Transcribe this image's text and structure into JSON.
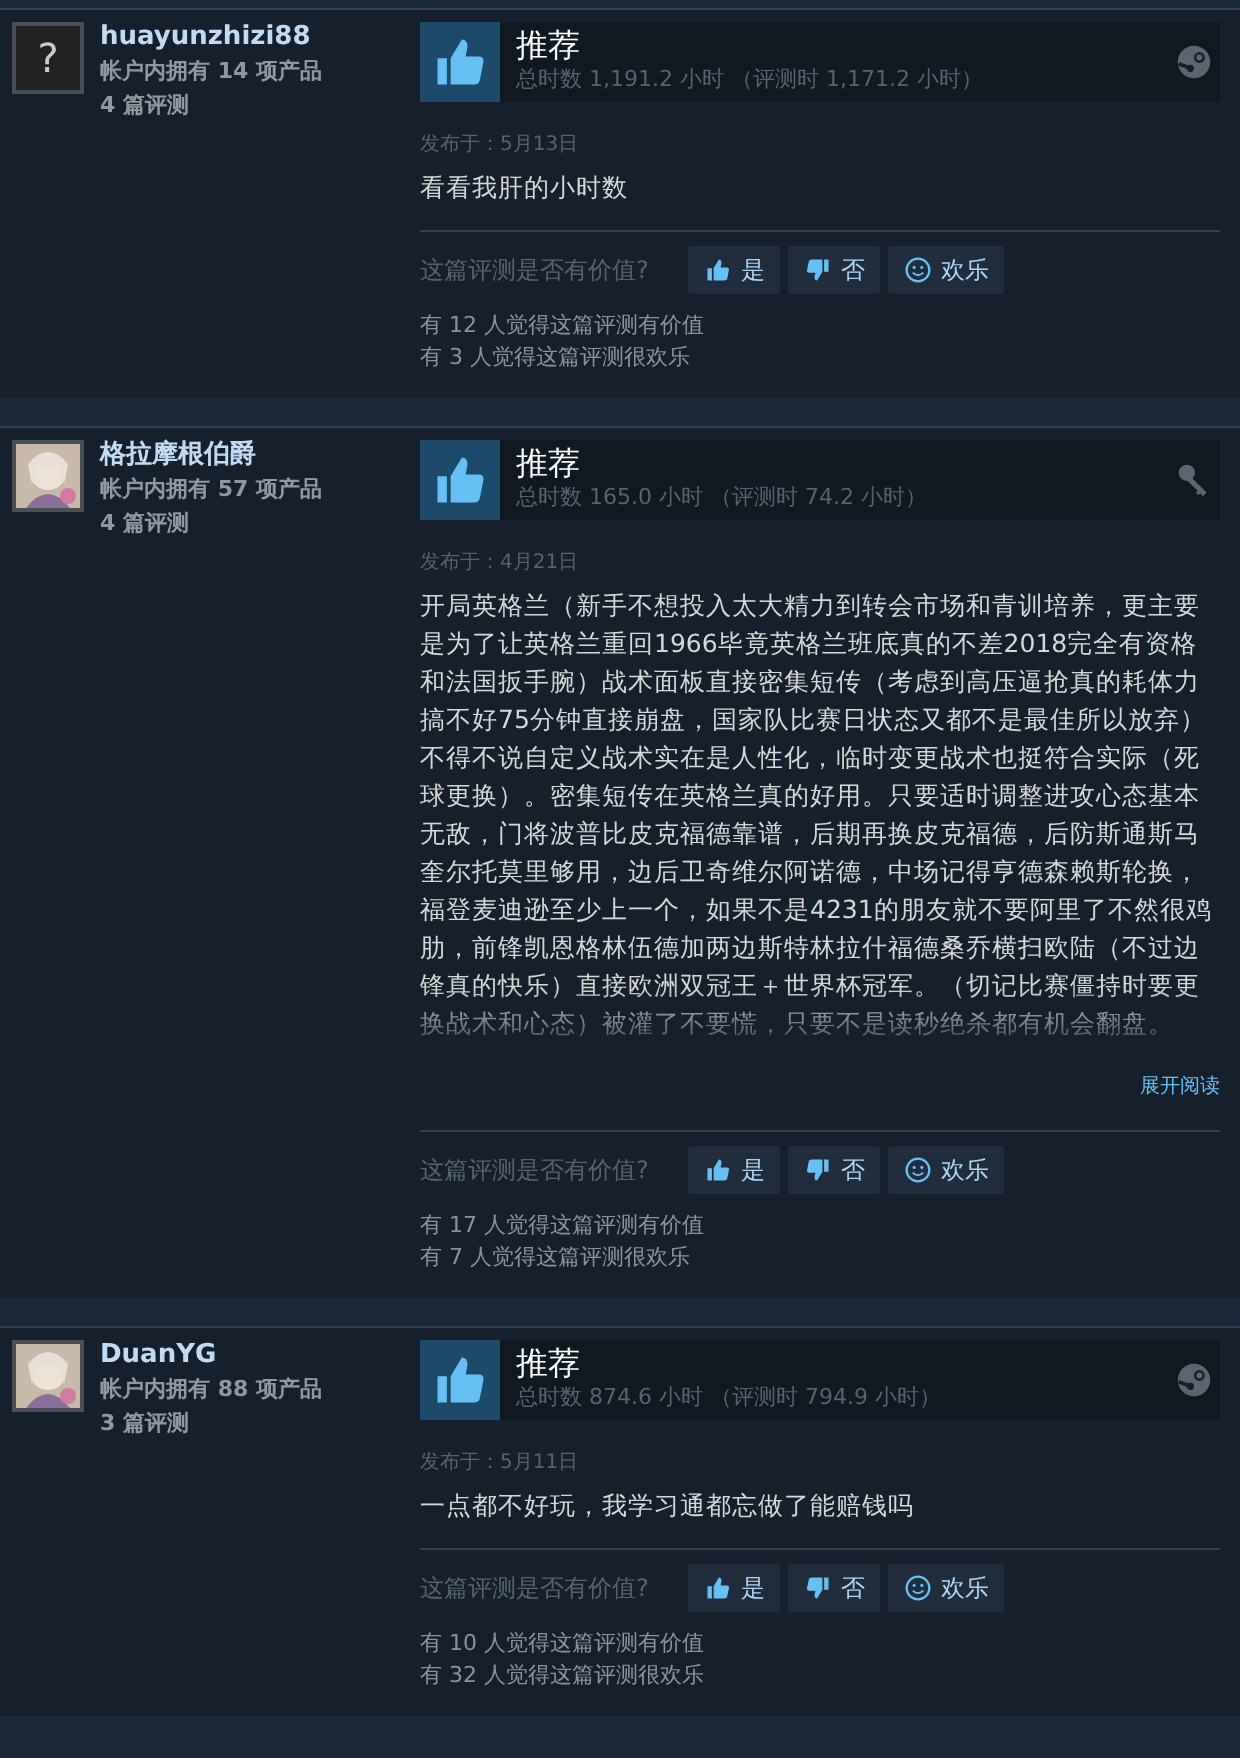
{
  "reviews": [
    {
      "author": {
        "name": "huayunzhizi88",
        "avatar": {
          "kind": "unknown",
          "text": "?"
        },
        "products": "帐户内拥有 14 项产品",
        "review_count": "4 篇评测"
      },
      "verdict": "推荐",
      "hours": "总时数 1,191.2 小时 （评测时 1,171.2 小时）",
      "product": {
        "kind": "steam"
      },
      "posted": "发布于：5月13日",
      "text": "看看我肝的小时数",
      "helpful_prompt": "这篇评测是否有价值?",
      "buttons": [
        {
          "kind": "up",
          "label": "是"
        },
        {
          "kind": "down",
          "label": "否"
        },
        {
          "kind": "funny",
          "label": "欢乐"
        }
      ],
      "counts": [
        "有 12 人觉得这篇评测有价值",
        "有 3 人觉得这篇评测很欢乐"
      ]
    },
    {
      "author": {
        "name": "格拉摩根伯爵",
        "products": "帐户内拥有 57 项产品",
        "review_count": "4 篇评测"
      },
      "verdict": "推荐",
      "hours": "总时数 165.0 小时 （评测时 74.2 小时）",
      "product": {
        "kind": "key"
      },
      "posted": "发布于：4月21日",
      "text": "开局英格兰（新手不想投入太大精力到转会市场和青训培养，更主要是为了让英格兰重回1966毕竟英格兰班底真的不差2018完全有资格和法国扳手腕）战术面板直接密集短传（考虑到高压逼抢真的耗体力搞不好75分钟直接崩盘，国家队比赛日状态又都不是最佳所以放弃）不得不说自定义战术实在是人性化，临时变更战术也挺符合实际（死球更换）。密集短传在英格兰真的好用。只要适时调整进攻心态基本无敌，门将波普比皮克福德靠谱，后期再换皮克福德，后防斯通斯马奎尔托莫里够用，边后卫奇维尔阿诺德，中场记得亨德森赖斯轮换，福登麦迪逊至少上一个，如果不是4231的朋友就不要阿里了不然很鸡肋，前锋凯恩格林伍德加两边斯特林拉什福德桑乔横扫欧陆（不过边锋真的快乐）直接欧洲双冠王＋世界杯冠军。（切记比赛僵持时要更换战术和心态）被灌了不要慌，只要不是读秒绝杀都有机会翻盘。",
      "truncated": true,
      "expand_link": "展开阅读",
      "helpful_prompt": "这篇评测是否有价值?",
      "buttons": [
        {
          "kind": "up",
          "label": "是"
        },
        {
          "kind": "down",
          "label": "否"
        },
        {
          "kind": "funny",
          "label": "欢乐"
        }
      ],
      "counts": [
        "有 17 人觉得这篇评测有价值",
        "有 7 人觉得这篇评测很欢乐"
      ]
    },
    {
      "author": {
        "name": "DuanYG",
        "products": "帐户内拥有 88 项产品",
        "review_count": "3 篇评测"
      },
      "verdict": "推荐",
      "hours": "总时数 874.6 小时 （评测时 794.9 小时）",
      "product": {
        "kind": "steam"
      },
      "posted": "发布于：5月11日",
      "text": "一点都不好玩，我学习通都忘做了能赔钱吗",
      "helpful_prompt": "这篇评测是否有价值?",
      "buttons": [
        {
          "kind": "up",
          "label": "是"
        },
        {
          "kind": "down",
          "label": "否"
        },
        {
          "kind": "funny",
          "label": "欢乐"
        }
      ],
      "counts": [
        "有 10 人觉得这篇评测有价值",
        "有 32 人觉得这篇评测很欢乐"
      ]
    }
  ]
}
